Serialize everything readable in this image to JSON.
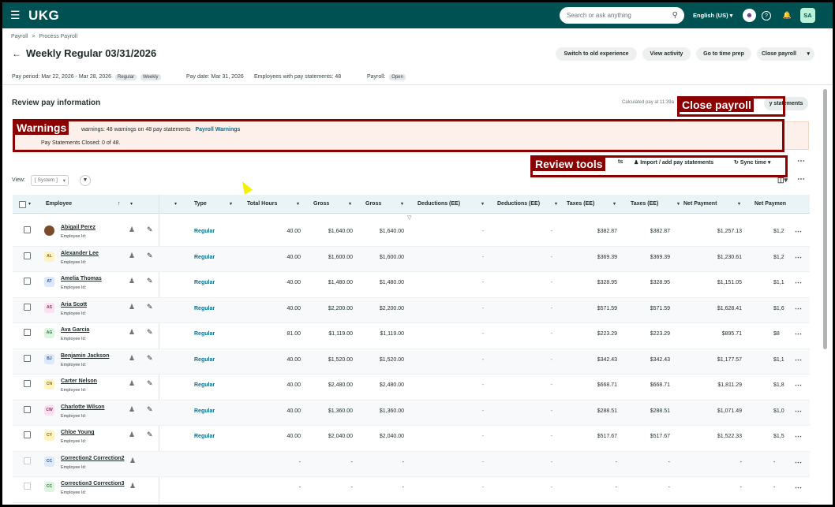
{
  "topbar": {
    "brand": "UKG",
    "search_placeholder": "Search or ask anything",
    "language": "English (US)",
    "user_initials": "SA"
  },
  "breadcrumb": {
    "root": "Payroll",
    "separator": ">",
    "current": "Process Payroll"
  },
  "header": {
    "title": "Weekly Regular 03/31/2026",
    "buttons": {
      "old_experience": "Switch to old experience",
      "view_activity": "View activity",
      "time_prep": "Go to time prep",
      "close_payroll": "Close payroll"
    }
  },
  "meta": {
    "pay_period": "Pay period: Mar 22, 2026 - Mar 28, 2026",
    "tag_regular": "Regular",
    "tag_weekly": "Weekly",
    "pay_date": "Pay date: Mar 31, 2026",
    "employees": "Employees with pay statements: 48",
    "payroll_label": "Payroll:",
    "payroll_status": "Open"
  },
  "review": {
    "title": "Review pay information",
    "calculated": "Calculated pay at 11:39a",
    "statements_btn": "y statements"
  },
  "warnings": {
    "text": "warnings: 48 warnings on 48 pay statements",
    "link": "Payroll Warnings",
    "closed": "Pay Statements Closed: 0 of 48."
  },
  "toolbar": {
    "partial": "ts",
    "import": "Import / add pay statements",
    "sync": "Sync time",
    "view_label": "View:",
    "view_value": "[ System ]"
  },
  "annotations": {
    "close_payroll": "Close payroll",
    "warnings": "Warnings",
    "review_tools": "Review tools"
  },
  "table": {
    "headers": [
      "Employee",
      "Type",
      "Total Hours",
      "Gross",
      "Gross",
      "Deductions (EE)",
      "Deductions (EE)",
      "Taxes (EE)",
      "Taxes (EE)",
      "Net Payment",
      "Net Paymen"
    ],
    "employee_id_label": "Employee Id:",
    "rows": [
      {
        "name": "Abigail Perez",
        "initials": "",
        "type": "Regular",
        "hours": "40.00",
        "gross1": "$1,640.00",
        "gross2": "$1,640.00",
        "ded1": "-",
        "ded2": "-",
        "tax1": "$382.87",
        "tax2": "$382.87",
        "net1": "$1,257.13",
        "net2": "$1,2",
        "avcolor": "#7a4a2a",
        "avbg": "#7a4a2a"
      },
      {
        "name": "Alexander Lee",
        "initials": "AL",
        "type": "Regular",
        "hours": "40.00",
        "gross1": "$1,600.00",
        "gross2": "$1,600.00",
        "ded1": "-",
        "ded2": "-",
        "tax1": "$369.39",
        "tax2": "$369.39",
        "net1": "$1,230.61",
        "net2": "$1,2",
        "avcolor": "#8a6a00",
        "avbg": "#fff3c4"
      },
      {
        "name": "Amelia Thomas",
        "initials": "AT",
        "type": "Regular",
        "hours": "40.00",
        "gross1": "$1,480.00",
        "gross2": "$1,480.00",
        "ded1": "-",
        "ded2": "-",
        "tax1": "$328.95",
        "tax2": "$328.95",
        "net1": "$1,151.05",
        "net2": "$1,1",
        "avcolor": "#2a5a9a",
        "avbg": "#dde9fb"
      },
      {
        "name": "Aria Scott",
        "initials": "AS",
        "type": "Regular",
        "hours": "40.00",
        "gross1": "$2,200.00",
        "gross2": "$2,200.00",
        "ded1": "-",
        "ded2": "-",
        "tax1": "$571.59",
        "tax2": "$571.59",
        "net1": "$1,628.41",
        "net2": "$1,6",
        "avcolor": "#9a2a6a",
        "avbg": "#fbe0ee"
      },
      {
        "name": "Ava Garcia",
        "initials": "AG",
        "type": "Regular",
        "hours": "81.00",
        "gross1": "$1,119.00",
        "gross2": "$1,119.00",
        "ded1": "-",
        "ded2": "-",
        "tax1": "$223.29",
        "tax2": "$223.29",
        "net1": "$895.71",
        "net2": "$8",
        "avcolor": "#2a7a3a",
        "avbg": "#dcf5e0"
      },
      {
        "name": "Benjamin Jackson",
        "initials": "BJ",
        "type": "Regular",
        "hours": "40.00",
        "gross1": "$1,520.00",
        "gross2": "$1,520.00",
        "ded1": "-",
        "ded2": "-",
        "tax1": "$342.43",
        "tax2": "$342.43",
        "net1": "$1,177.57",
        "net2": "$1,1",
        "avcolor": "#2a5a9a",
        "avbg": "#dde9fb"
      },
      {
        "name": "Carter Nelson",
        "initials": "CN",
        "type": "Regular",
        "hours": "40.00",
        "gross1": "$2,480.00",
        "gross2": "$2,480.00",
        "ded1": "-",
        "ded2": "-",
        "tax1": "$668.71",
        "tax2": "$668.71",
        "net1": "$1,811.29",
        "net2": "$1,8",
        "avcolor": "#8a6a00",
        "avbg": "#fff3c4"
      },
      {
        "name": "Charlotte Wilson",
        "initials": "CW",
        "type": "Regular",
        "hours": "40.00",
        "gross1": "$1,360.00",
        "gross2": "$1,360.00",
        "ded1": "-",
        "ded2": "-",
        "tax1": "$288.51",
        "tax2": "$288.51",
        "net1": "$1,071.49",
        "net2": "$1,0",
        "avcolor": "#9a2a6a",
        "avbg": "#fbe0ee"
      },
      {
        "name": "Chloe Young",
        "initials": "CY",
        "type": "Regular",
        "hours": "40.00",
        "gross1": "$2,040.00",
        "gross2": "$2,040.00",
        "ded1": "-",
        "ded2": "-",
        "tax1": "$517.67",
        "tax2": "$517.67",
        "net1": "$1,522.33",
        "net2": "$1,5",
        "avcolor": "#8a6a00",
        "avbg": "#fff3c4"
      },
      {
        "name": "Correction2 Correction2",
        "initials": "CC",
        "type": "",
        "hours": "-",
        "gross1": "-",
        "gross2": "-",
        "ded1": "-",
        "ded2": "-",
        "tax1": "-",
        "tax2": "-",
        "net1": "-",
        "net2": "-",
        "avcolor": "#2a5a9a",
        "avbg": "#dde9fb"
      },
      {
        "name": "Correction3 Correction3",
        "initials": "CC",
        "type": "",
        "hours": "-",
        "gross1": "-",
        "gross2": "-",
        "ded1": "-",
        "ded2": "-",
        "tax1": "-",
        "tax2": "-",
        "net1": "-",
        "net2": "-",
        "avcolor": "#2a7a3a",
        "avbg": "#dcf5e0"
      }
    ]
  }
}
